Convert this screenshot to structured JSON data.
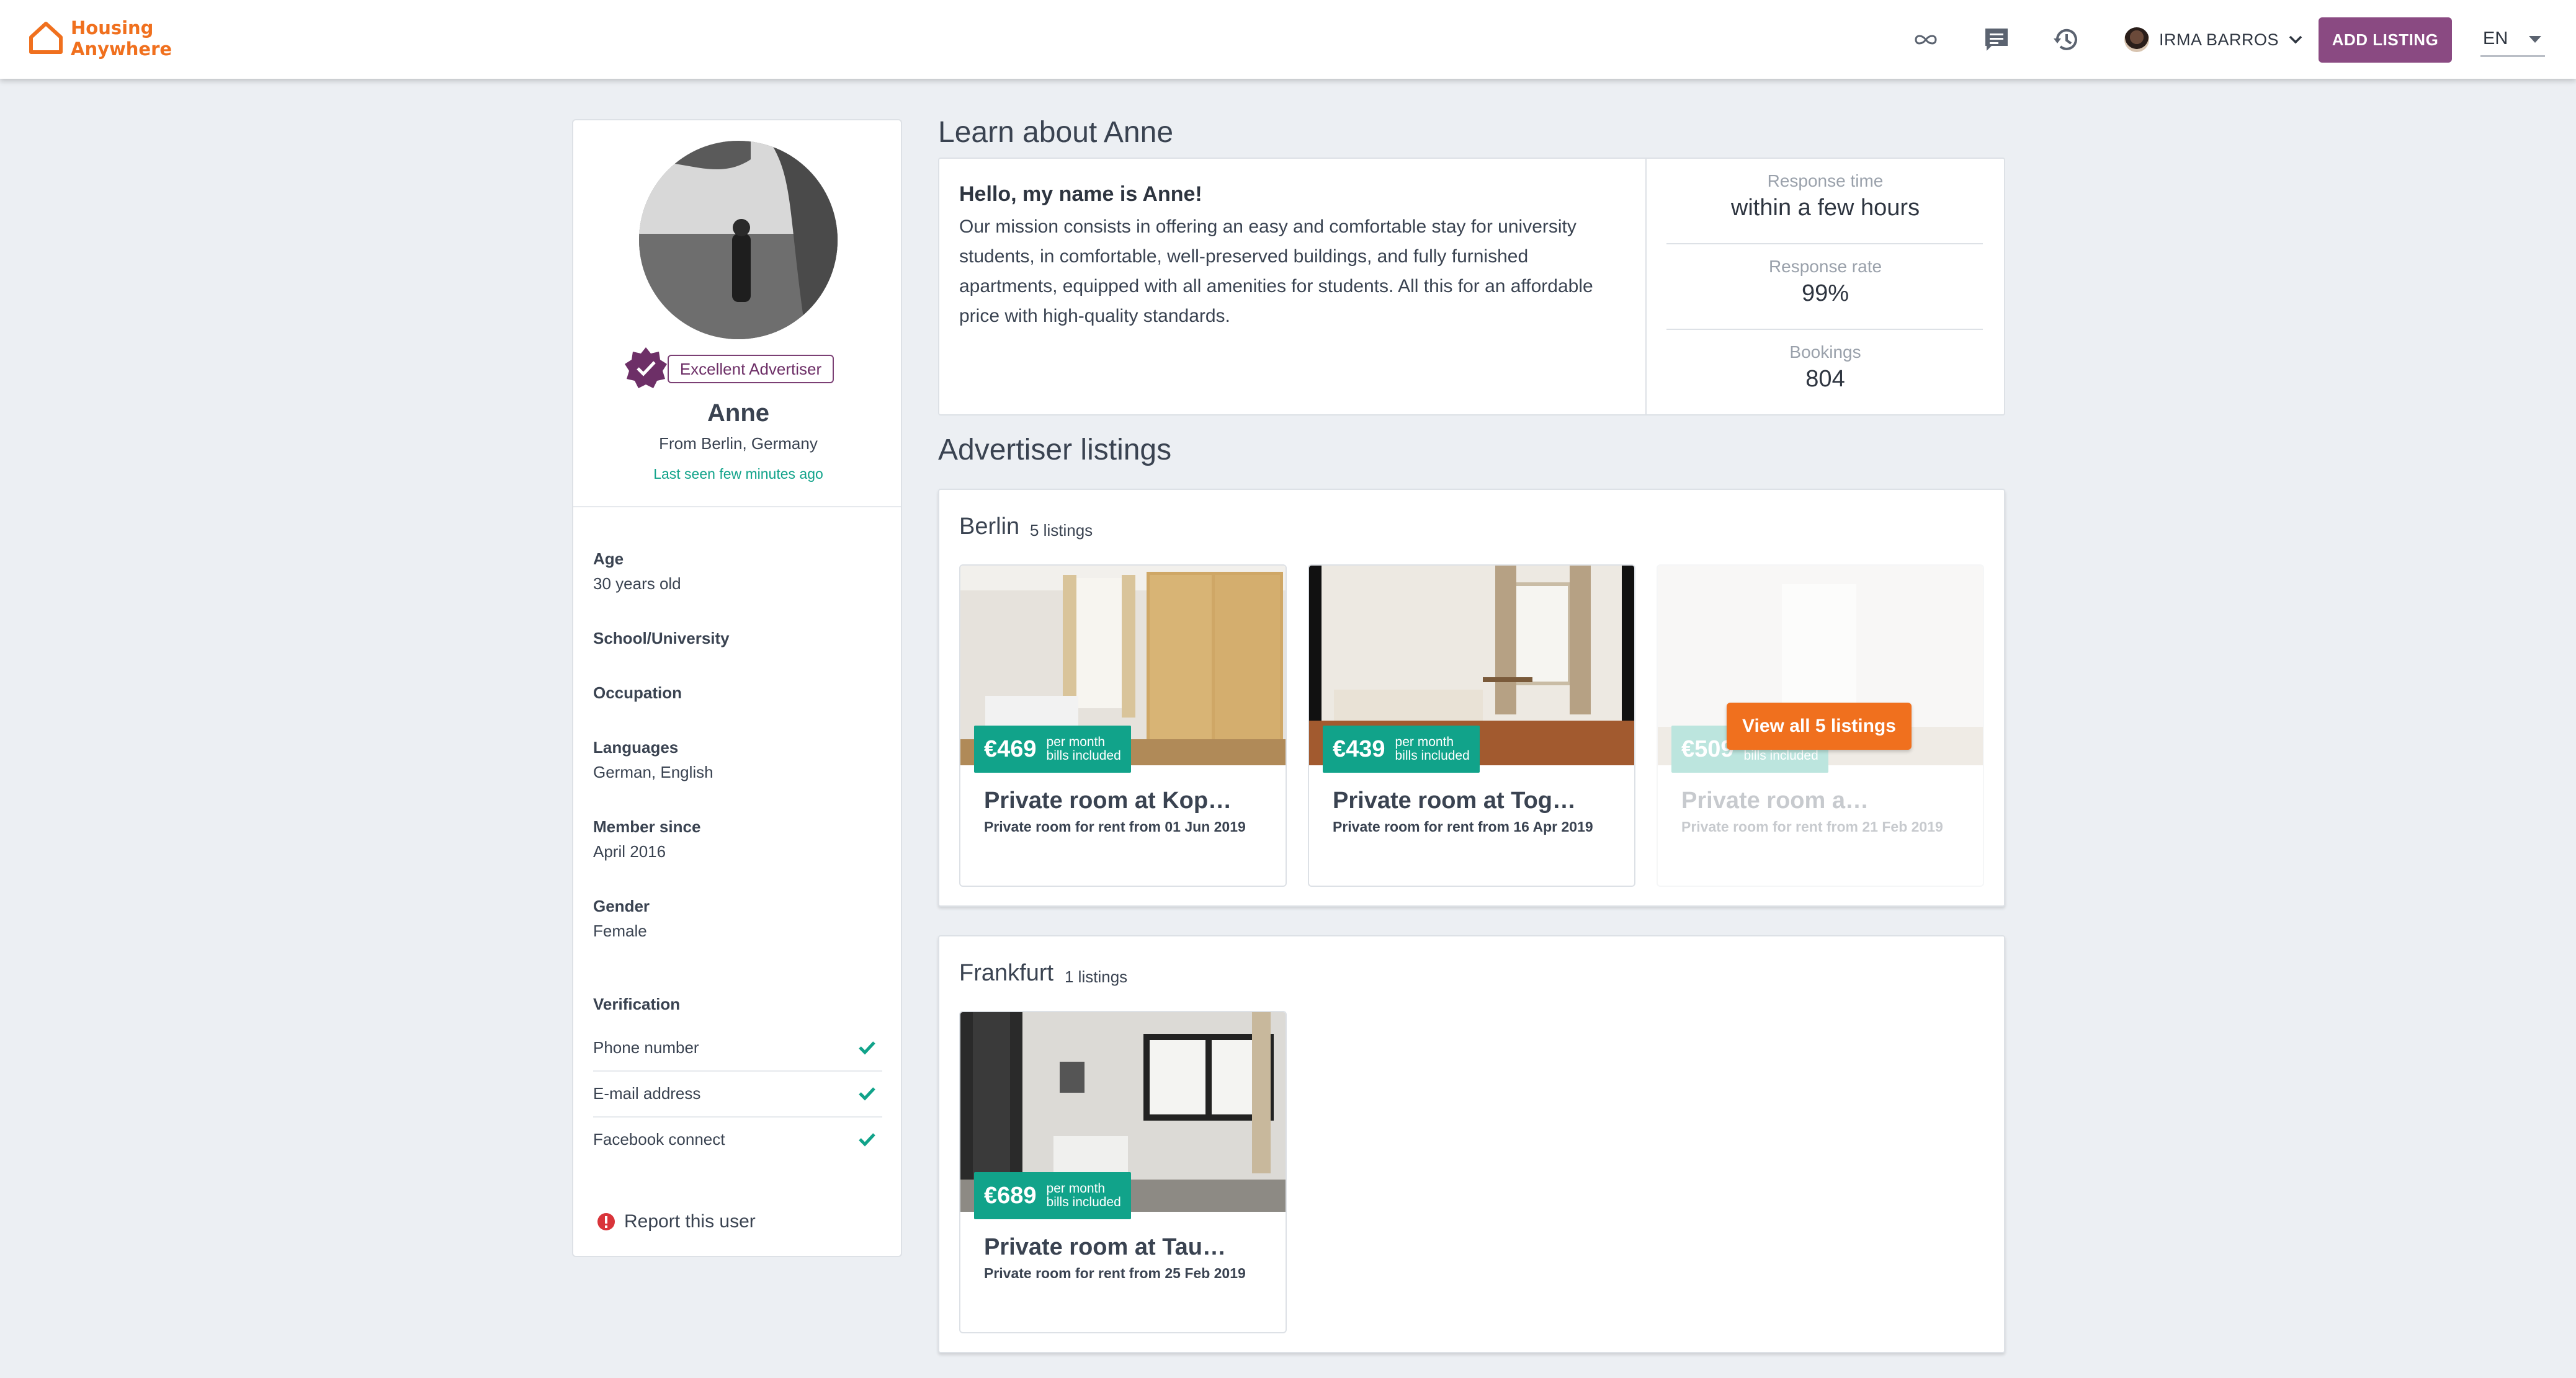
{
  "colors": {
    "brand": "#f0701e",
    "accent_purple": "#8a4a82",
    "teal": "#11a38a",
    "background": "#eceff3"
  },
  "navbar": {
    "logo_line1": "Housing",
    "logo_line2": "Anywhere",
    "icons": [
      "infinity-icon",
      "chat-icon",
      "history-icon"
    ],
    "user_name": "IRMA BARROS",
    "add_listing_label": "ADD LISTING",
    "language": "EN"
  },
  "profile": {
    "badge": "Excellent Advertiser",
    "name": "Anne",
    "from": "From Berlin, Germany",
    "last_seen": "Last seen few minutes ago",
    "fields": [
      {
        "label": "Age",
        "value": "30 years old"
      },
      {
        "label": "School/University",
        "value": ""
      },
      {
        "label": "Occupation",
        "value": ""
      },
      {
        "label": "Languages",
        "value": "German, English"
      },
      {
        "label": "Member since",
        "value": "April 2016"
      },
      {
        "label": "Gender",
        "value": "Female"
      }
    ],
    "verification_title": "Verification",
    "verifications": [
      "Phone number",
      "E-mail address",
      "Facebook connect"
    ],
    "report_label": "Report this user"
  },
  "about": {
    "heading": "Learn about Anne",
    "hello": "Hello, my name is Anne!",
    "body": "Our mission consists in offering an easy and comfortable stay for university students, in comfortable, well-preserved buildings, and fully furnished apartments, equipped with all amenities for students. All this for an affordable price with high-quality standards.",
    "stats": [
      {
        "label": "Response time",
        "value": "within a few hours"
      },
      {
        "label": "Response rate",
        "value": "99%"
      },
      {
        "label": "Bookings",
        "value": "804"
      }
    ]
  },
  "listings": {
    "heading": "Advertiser listings",
    "price_per": "per month",
    "price_bills": "bills included",
    "view_all_label": "View all 5 listings",
    "cities": [
      {
        "name": "Berlin",
        "count": "5 listings",
        "items": [
          {
            "price": "€469",
            "title": "Private room at Kop…",
            "subtitle": "Private room for rent from 01 Jun 2019"
          },
          {
            "price": "€439",
            "title": "Private room at Tog…",
            "subtitle": "Private room for rent from 16 Apr 2019"
          },
          {
            "price": "€509",
            "title": "Private room a…",
            "subtitle": "Private room for rent from 21 Feb 2019"
          }
        ]
      },
      {
        "name": "Frankfurt",
        "count": "1 listings",
        "items": [
          {
            "price": "€689",
            "title": "Private room at Tau…",
            "subtitle": "Private room for rent from 25 Feb 2019"
          }
        ]
      }
    ]
  }
}
